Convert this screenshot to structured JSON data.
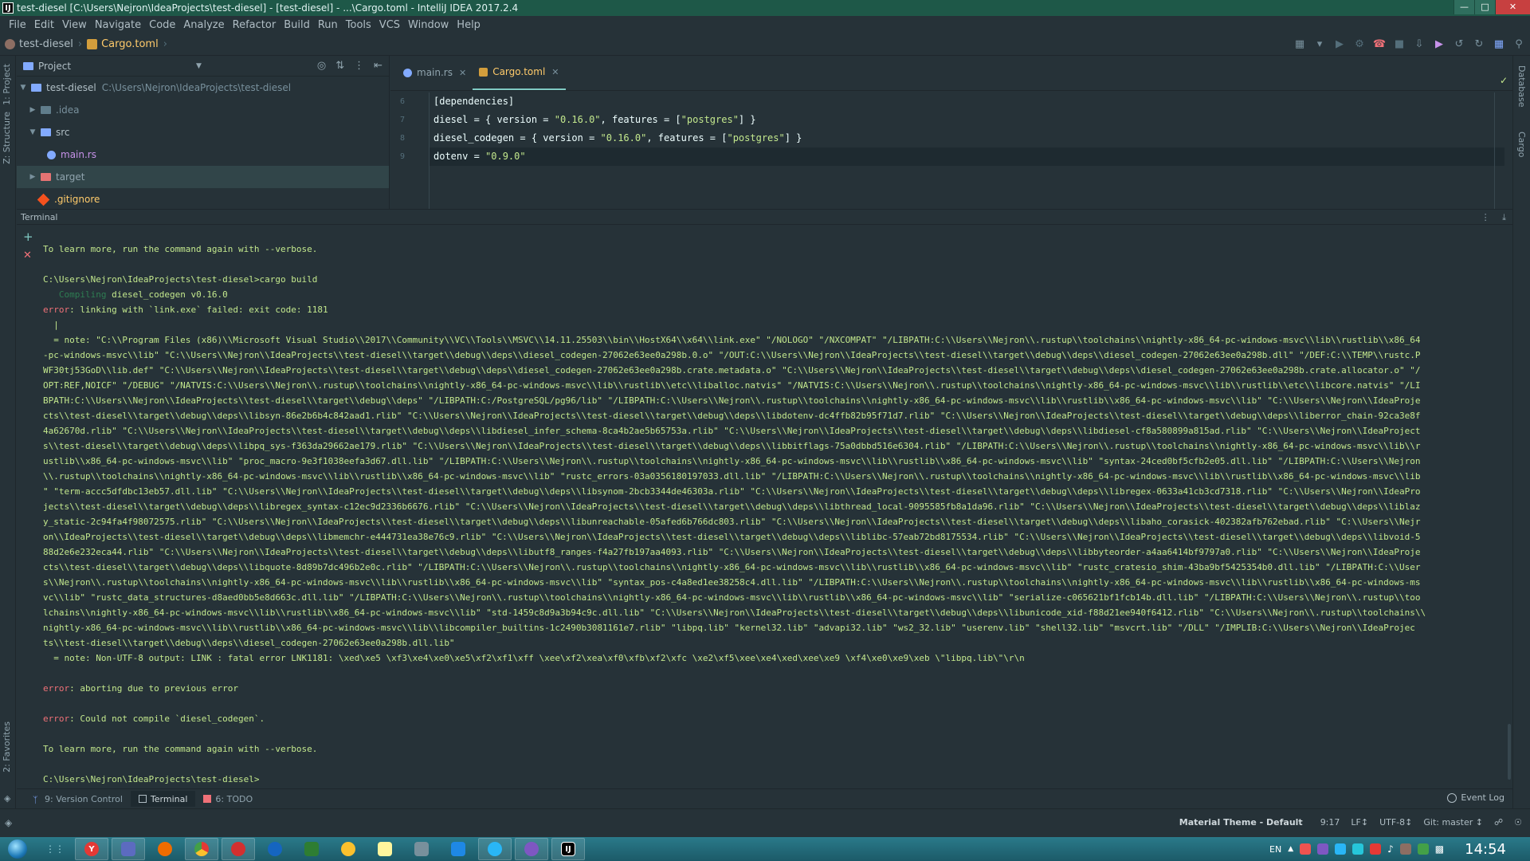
{
  "window": {
    "title": "test-diesel [C:\\Users\\Nejron\\IdeaProjects\\test-diesel] - [test-diesel] - ...\\Cargo.toml - IntelliJ IDEA 2017.2.4"
  },
  "menu": [
    "File",
    "Edit",
    "View",
    "Navigate",
    "Code",
    "Analyze",
    "Refactor",
    "Build",
    "Run",
    "Tools",
    "VCS",
    "Window",
    "Help"
  ],
  "breadcrumb": {
    "project": "test-diesel",
    "file": "Cargo.toml"
  },
  "side_tabs": {
    "project": "1: Project",
    "structure": "Z: Structure",
    "favorites": "2: Favorites",
    "database": "Database",
    "cargo": "Cargo"
  },
  "project_panel": {
    "title": "Project",
    "tree": [
      {
        "name": "test-diesel",
        "path": "C:\\Users\\Nejron\\IdeaProjects\\test-diesel"
      },
      {
        "name": ".idea"
      },
      {
        "name": "src"
      },
      {
        "name": "main.rs"
      },
      {
        "name": "target"
      },
      {
        "name": ".gitignore"
      }
    ]
  },
  "editor": {
    "tabs": [
      {
        "label": "main.rs"
      },
      {
        "label": "Cargo.toml"
      }
    ],
    "line_numbers": [
      "6",
      "7",
      "8",
      "9"
    ],
    "lines": [
      {
        "k": "[dependencies]",
        "s": "",
        "e": ""
      },
      {
        "k": "diesel = { version = ",
        "s": "\"0.16.0\"",
        "m": ", features = [",
        "s2": "\"postgres\"",
        "e": "] }"
      },
      {
        "k": "diesel_codegen = { version = ",
        "s": "\"0.16.0\"",
        "m": ", features = [",
        "s2": "\"postgres\"",
        "e": "] }"
      },
      {
        "k": "dotenv = ",
        "s": "\"0.9.0\"",
        "e": ""
      }
    ]
  },
  "terminal": {
    "title": "Terminal",
    "lines": [
      "To learn more, run the command again with --verbose.",
      "",
      "C:\\Users\\Nejron\\IdeaProjects\\test-diesel>cargo build",
      "   Compiling diesel_codegen v0.16.0",
      "error: linking with `link.exe` failed: exit code: 1181",
      "  |",
      "  = note: \"C:\\\\Program Files (x86)\\\\Microsoft Visual Studio\\\\2017\\\\Community\\\\VC\\\\Tools\\\\MSVC\\\\14.11.25503\\\\bin\\\\HostX64\\\\x64\\\\link.exe\" \"/NOLOGO\" \"/NXCOMPAT\" \"/LIBPATH:C:\\\\Users\\\\Nejron\\\\.rustup\\\\toolchains\\\\nightly-x86_64-pc-windows-msvc\\\\lib\\\\rustlib\\\\x86_64",
      "-pc-windows-msvc\\\\lib\" \"C:\\\\Users\\\\Nejron\\\\IdeaProjects\\\\test-diesel\\\\target\\\\debug\\\\deps\\\\diesel_codegen-27062e63ee0a298b.0.o\" \"/OUT:C:\\\\Users\\\\Nejron\\\\IdeaProjects\\\\test-diesel\\\\target\\\\debug\\\\deps\\\\diesel_codegen-27062e63ee0a298b.dll\" \"/DEF:C:\\\\TEMP\\\\rustc.P",
      "WF30tj53GoD\\\\lib.def\" \"C:\\\\Users\\\\Nejron\\\\IdeaProjects\\\\test-diesel\\\\target\\\\debug\\\\deps\\\\diesel_codegen-27062e63ee0a298b.crate.metadata.o\" \"C:\\\\Users\\\\Nejron\\\\IdeaProjects\\\\test-diesel\\\\target\\\\debug\\\\deps\\\\diesel_codegen-27062e63ee0a298b.crate.allocator.o\" \"/",
      "OPT:REF,NOICF\" \"/DEBUG\" \"/NATVIS:C:\\\\Users\\\\Nejron\\\\.rustup\\\\toolchains\\\\nightly-x86_64-pc-windows-msvc\\\\lib\\\\rustlib\\\\etc\\\\liballoc.natvis\" \"/NATVIS:C:\\\\Users\\\\Nejron\\\\.rustup\\\\toolchains\\\\nightly-x86_64-pc-windows-msvc\\\\lib\\\\rustlib\\\\etc\\\\libcore.natvis\" \"/LI",
      "BPATH:C:\\\\Users\\\\Nejron\\\\IdeaProjects\\\\test-diesel\\\\target\\\\debug\\\\deps\" \"/LIBPATH:C:/PostgreSQL/pg96/lib\" \"/LIBPATH:C:\\\\Users\\\\Nejron\\\\.rustup\\\\toolchains\\\\nightly-x86_64-pc-windows-msvc\\\\lib\\\\rustlib\\\\x86_64-pc-windows-msvc\\\\lib\" \"C:\\\\Users\\\\Nejron\\\\IdeaProje",
      "cts\\\\test-diesel\\\\target\\\\debug\\\\deps\\\\libsyn-86e2b6b4c842aad1.rlib\" \"C:\\\\Users\\\\Nejron\\\\IdeaProjects\\\\test-diesel\\\\target\\\\debug\\\\deps\\\\libdotenv-dc4ffb82b95f71d7.rlib\" \"C:\\\\Users\\\\Nejron\\\\IdeaProjects\\\\test-diesel\\\\target\\\\debug\\\\deps\\\\liberror_chain-92ca3e8f",
      "4a62670d.rlib\" \"C:\\\\Users\\\\Nejron\\\\IdeaProjects\\\\test-diesel\\\\target\\\\debug\\\\deps\\\\libdiesel_infer_schema-8ca4b2ae5b65753a.rlib\" \"C:\\\\Users\\\\Nejron\\\\IdeaProjects\\\\test-diesel\\\\target\\\\debug\\\\deps\\\\libdiesel-cf8a580899a815ad.rlib\" \"C:\\\\Users\\\\Nejron\\\\IdeaProject",
      "s\\\\test-diesel\\\\target\\\\debug\\\\deps\\\\libpq_sys-f363da29662ae179.rlib\" \"C:\\\\Users\\\\Nejron\\\\IdeaProjects\\\\test-diesel\\\\target\\\\debug\\\\deps\\\\libbitflags-75a0dbbd516e6304.rlib\" \"/LIBPATH:C:\\\\Users\\\\Nejron\\\\.rustup\\\\toolchains\\\\nightly-x86_64-pc-windows-msvc\\\\lib\\\\r",
      "ustlib\\\\x86_64-pc-windows-msvc\\\\lib\" \"proc_macro-9e3f1038eefa3d67.dll.lib\" \"/LIBPATH:C:\\\\Users\\\\Nejron\\\\.rustup\\\\toolchains\\\\nightly-x86_64-pc-windows-msvc\\\\lib\\\\rustlib\\\\x86_64-pc-windows-msvc\\\\lib\" \"syntax-24ced0bf5cfb2e05.dll.lib\" \"/LIBPATH:C:\\\\Users\\\\Nejron",
      "\\\\.rustup\\\\toolchains\\\\nightly-x86_64-pc-windows-msvc\\\\lib\\\\rustlib\\\\x86_64-pc-windows-msvc\\\\lib\" \"rustc_errors-03a0356180197033.dll.lib\" \"/LIBPATH:C:\\\\Users\\\\Nejron\\\\.rustup\\\\toolchains\\\\nightly-x86_64-pc-windows-msvc\\\\lib\\\\rustlib\\\\x86_64-pc-windows-msvc\\\\lib",
      "\" \"term-accc5dfdbc13eb57.dll.lib\" \"C:\\\\Users\\\\Nejron\\\\IdeaProjects\\\\test-diesel\\\\target\\\\debug\\\\deps\\\\libsynom-2bcb3344de46303a.rlib\" \"C:\\\\Users\\\\Nejron\\\\IdeaProjects\\\\test-diesel\\\\target\\\\debug\\\\deps\\\\libregex-0633a41cb3cd7318.rlib\" \"C:\\\\Users\\\\Nejron\\\\IdeaPro",
      "jects\\\\test-diesel\\\\target\\\\debug\\\\deps\\\\libregex_syntax-c12ec9d2336b6676.rlib\" \"C:\\\\Users\\\\Nejron\\\\IdeaProjects\\\\test-diesel\\\\target\\\\debug\\\\deps\\\\libthread_local-9095585fb8a1da96.rlib\" \"C:\\\\Users\\\\Nejron\\\\IdeaProjects\\\\test-diesel\\\\target\\\\debug\\\\deps\\\\liblaz",
      "y_static-2c94fa4f98072575.rlib\" \"C:\\\\Users\\\\Nejron\\\\IdeaProjects\\\\test-diesel\\\\target\\\\debug\\\\deps\\\\libunreachable-05afed6b766dc803.rlib\" \"C:\\\\Users\\\\Nejron\\\\IdeaProjects\\\\test-diesel\\\\target\\\\debug\\\\deps\\\\libaho_corasick-402382afb762ebad.rlib\" \"C:\\\\Users\\\\Nejr",
      "on\\\\IdeaProjects\\\\test-diesel\\\\target\\\\debug\\\\deps\\\\libmemchr-e444731ea38e76c9.rlib\" \"C:\\\\Users\\\\Nejron\\\\IdeaProjects\\\\test-diesel\\\\target\\\\debug\\\\deps\\\\liblibc-57eab72bd8175534.rlib\" \"C:\\\\Users\\\\Nejron\\\\IdeaProjects\\\\test-diesel\\\\target\\\\debug\\\\deps\\\\libvoid-5",
      "88d2e6e232eca44.rlib\" \"C:\\\\Users\\\\Nejron\\\\IdeaProjects\\\\test-diesel\\\\target\\\\debug\\\\deps\\\\libutf8_ranges-f4a27fb197aa4093.rlib\" \"C:\\\\Users\\\\Nejron\\\\IdeaProjects\\\\test-diesel\\\\target\\\\debug\\\\deps\\\\libbyteorder-a4aa6414bf9797a0.rlib\" \"C:\\\\Users\\\\Nejron\\\\IdeaProje",
      "cts\\\\test-diesel\\\\target\\\\debug\\\\deps\\\\libquote-8d89b7dc496b2e0c.rlib\" \"/LIBPATH:C:\\\\Users\\\\Nejron\\\\.rustup\\\\toolchains\\\\nightly-x86_64-pc-windows-msvc\\\\lib\\\\rustlib\\\\x86_64-pc-windows-msvc\\\\lib\" \"rustc_cratesio_shim-43ba9bf5425354b0.dll.lib\" \"/LIBPATH:C:\\\\User",
      "s\\\\Nejron\\\\.rustup\\\\toolchains\\\\nightly-x86_64-pc-windows-msvc\\\\lib\\\\rustlib\\\\x86_64-pc-windows-msvc\\\\lib\" \"syntax_pos-c4a8ed1ee38258c4.dll.lib\" \"/LIBPATH:C:\\\\Users\\\\Nejron\\\\.rustup\\\\toolchains\\\\nightly-x86_64-pc-windows-msvc\\\\lib\\\\rustlib\\\\x86_64-pc-windows-ms",
      "vc\\\\lib\" \"rustc_data_structures-d8aed0bb5e8d663c.dll.lib\" \"/LIBPATH:C:\\\\Users\\\\Nejron\\\\.rustup\\\\toolchains\\\\nightly-x86_64-pc-windows-msvc\\\\lib\\\\rustlib\\\\x86_64-pc-windows-msvc\\\\lib\" \"serialize-c065621bf1fcb14b.dll.lib\" \"/LIBPATH:C:\\\\Users\\\\Nejron\\\\.rustup\\\\too",
      "lchains\\\\nightly-x86_64-pc-windows-msvc\\\\lib\\\\rustlib\\\\x86_64-pc-windows-msvc\\\\lib\" \"std-1459c8d9a3b94c9c.dll.lib\" \"C:\\\\Users\\\\Nejron\\\\IdeaProjects\\\\test-diesel\\\\target\\\\debug\\\\deps\\\\libunicode_xid-f88d21ee940f6412.rlib\" \"C:\\\\Users\\\\Nejron\\\\.rustup\\\\toolchains\\\\",
      "nightly-x86_64-pc-windows-msvc\\\\lib\\\\rustlib\\\\x86_64-pc-windows-msvc\\\\lib\\\\libcompiler_builtins-1c2490b3081161e7.rlib\" \"libpq.lib\" \"kernel32.lib\" \"advapi32.lib\" \"ws2_32.lib\" \"userenv.lib\" \"shell32.lib\" \"msvcrt.lib\" \"/DLL\" \"/IMPLIB:C:\\\\Users\\\\Nejron\\\\IdeaProjec",
      "ts\\\\test-diesel\\\\target\\\\debug\\\\deps\\\\diesel_codegen-27062e63ee0a298b.dll.lib\"",
      "  = note: Non-UTF-8 output: LINK : fatal error LNK1181: \\xed\\xe5 \\xf3\\xe4\\xe0\\xe5\\xf2\\xf1\\xff \\xee\\xf2\\xea\\xf0\\xfb\\xf2\\xfc \\xe2\\xf5\\xee\\xe4\\xed\\xee\\xe9 \\xf4\\xe0\\xe9\\xeb \\\"libpq.lib\\\"\\r\\n",
      "",
      "error: aborting due to previous error",
      "",
      "error: Could not compile `diesel_codegen`.",
      "",
      "To learn more, run the command again with --verbose.",
      "",
      "C:\\Users\\Nejron\\IdeaProjects\\test-diesel>"
    ]
  },
  "toolwindows": [
    {
      "label": "9: Version Control"
    },
    {
      "label": "Terminal"
    },
    {
      "label": "6: TODO"
    }
  ],
  "event_log": "Event Log",
  "status": {
    "theme": "Material Theme - Default",
    "position": "9:17",
    "line_sep": "LF↕",
    "encoding": "UTF-8↕",
    "git": "Git: master ↕"
  },
  "taskbar": {
    "lang": "EN",
    "time": "14:54"
  }
}
